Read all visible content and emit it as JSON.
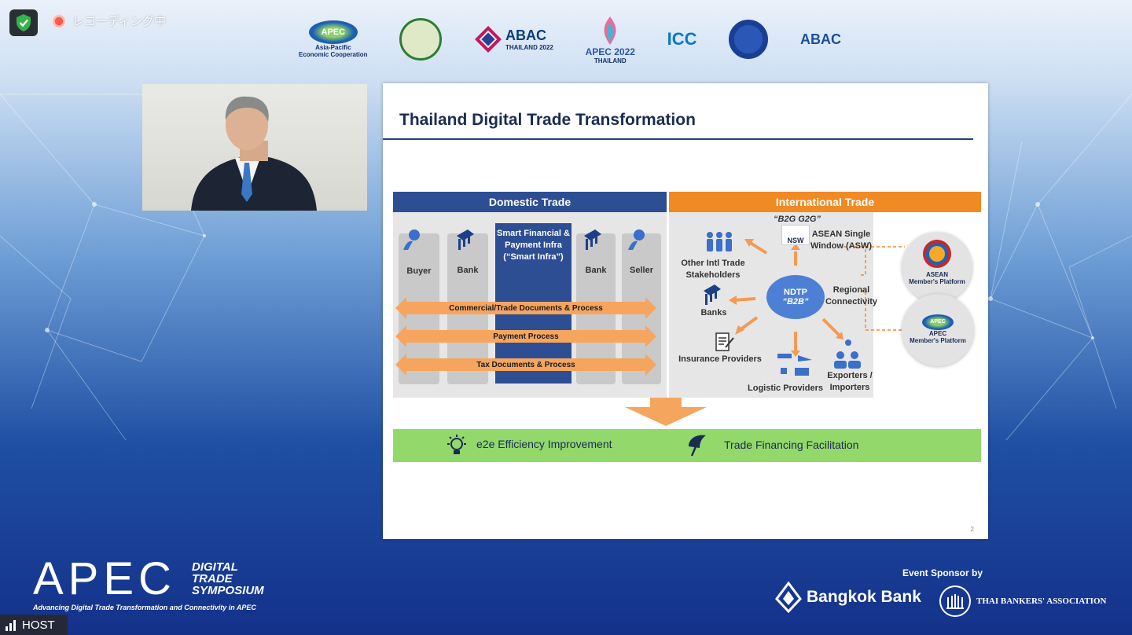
{
  "recording": {
    "label": "レコーディング中"
  },
  "logos": {
    "apec_text": "APEC",
    "apec_caption_1": "Asia-Pacific",
    "apec_caption_2": "Economic Cooperation",
    "abac_thailand": "ABAC",
    "abac_thailand_sub": "THAILAND 2022",
    "apec2022": "APEC 2022",
    "apec2022_sub": "THAILAND",
    "icc": "ICC",
    "abac": "ABAC"
  },
  "slide": {
    "title": "Thailand Digital Trade Transformation",
    "page_number": "2",
    "domestic": {
      "header": "Domestic Trade",
      "buyer": "Buyer",
      "bank_left": "Bank",
      "bank_right": "Bank",
      "seller": "Seller",
      "smart_infra": "Smart Financial & Payment Infra (“Smart Infra”)",
      "arrow_1": "Commercial/Trade Documents & Process",
      "arrow_2": "Payment Process",
      "arrow_3": "Tax Documents & Process"
    },
    "international": {
      "header": "International Trade",
      "b2g": "“B2G G2G”",
      "nsw": "NSW",
      "asw": "ASEAN Single Window (ASW)",
      "other_stakeholders": "Other Intl Trade Stakeholders",
      "ndtp": "NDTP",
      "b2b": "“B2B”",
      "regional": "Regional Connectivity",
      "banks": "Banks",
      "insurance": "Insurance Providers",
      "logistic": "Logistic Providers",
      "exporters": "Exporters / Importers",
      "asean_platform_1": "ASEAN",
      "asean_platform_2": "Member's Platform",
      "apec_platform_1": "APEC",
      "apec_platform_2": "Member's Platform"
    },
    "benefits": {
      "efficiency": "e2e Efficiency Improvement",
      "financing": "Trade Financing Facilitation"
    }
  },
  "branding": {
    "apec": "APEC",
    "digital": "DIGITAL",
    "trade": "TRADE",
    "symposium": "SYMPOSIUM",
    "tagline": "Advancing Digital Trade Transformation and Connectivity in APEC",
    "sponsor_label": "Event Sponsor by",
    "bangkok_bank": "Bangkok Bank",
    "thai_bankers": "THAI BANKERS' ASSOCIATION"
  },
  "host": {
    "label": "HOST"
  },
  "colors": {
    "domestic_header": "#2d4e93",
    "international_header": "#f08a23",
    "arrow": "#f6a55f",
    "benefits_band": "#92d86b",
    "ndtp": "#4d7fd4"
  }
}
